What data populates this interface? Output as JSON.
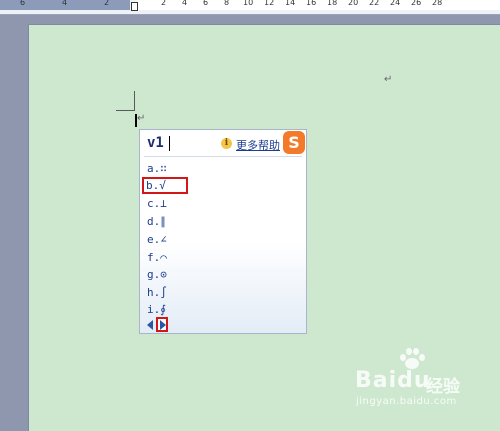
{
  "ruler": {
    "left_numbers": [
      "6",
      "4",
      "2"
    ],
    "right_numbers": [
      "2",
      "4",
      "6",
      "8",
      "10",
      "12",
      "14",
      "16",
      "18",
      "20",
      "22",
      "24",
      "26",
      "28"
    ]
  },
  "document": {
    "paragraph_mark": "↵",
    "background_color": "#cde8cf"
  },
  "ime": {
    "input_text": "v1",
    "help_label": "更多帮助",
    "logo_glyph": "S",
    "candidates": [
      {
        "label": "a.",
        "symbol": "∷"
      },
      {
        "label": "b.",
        "symbol": "√"
      },
      {
        "label": "c.",
        "symbol": "⊥"
      },
      {
        "label": "d.",
        "symbol": "∥"
      },
      {
        "label": "e.",
        "symbol": "∠"
      },
      {
        "label": "f.",
        "symbol": "⌒"
      },
      {
        "label": "g.",
        "symbol": "⊙"
      },
      {
        "label": "h.",
        "symbol": "∫"
      },
      {
        "label": "i.",
        "symbol": "∮"
      }
    ],
    "highlighted_index": 1
  },
  "watermark": {
    "brand": "Baidu",
    "chinese": "经验",
    "url": "jingyan.baidu.com"
  }
}
